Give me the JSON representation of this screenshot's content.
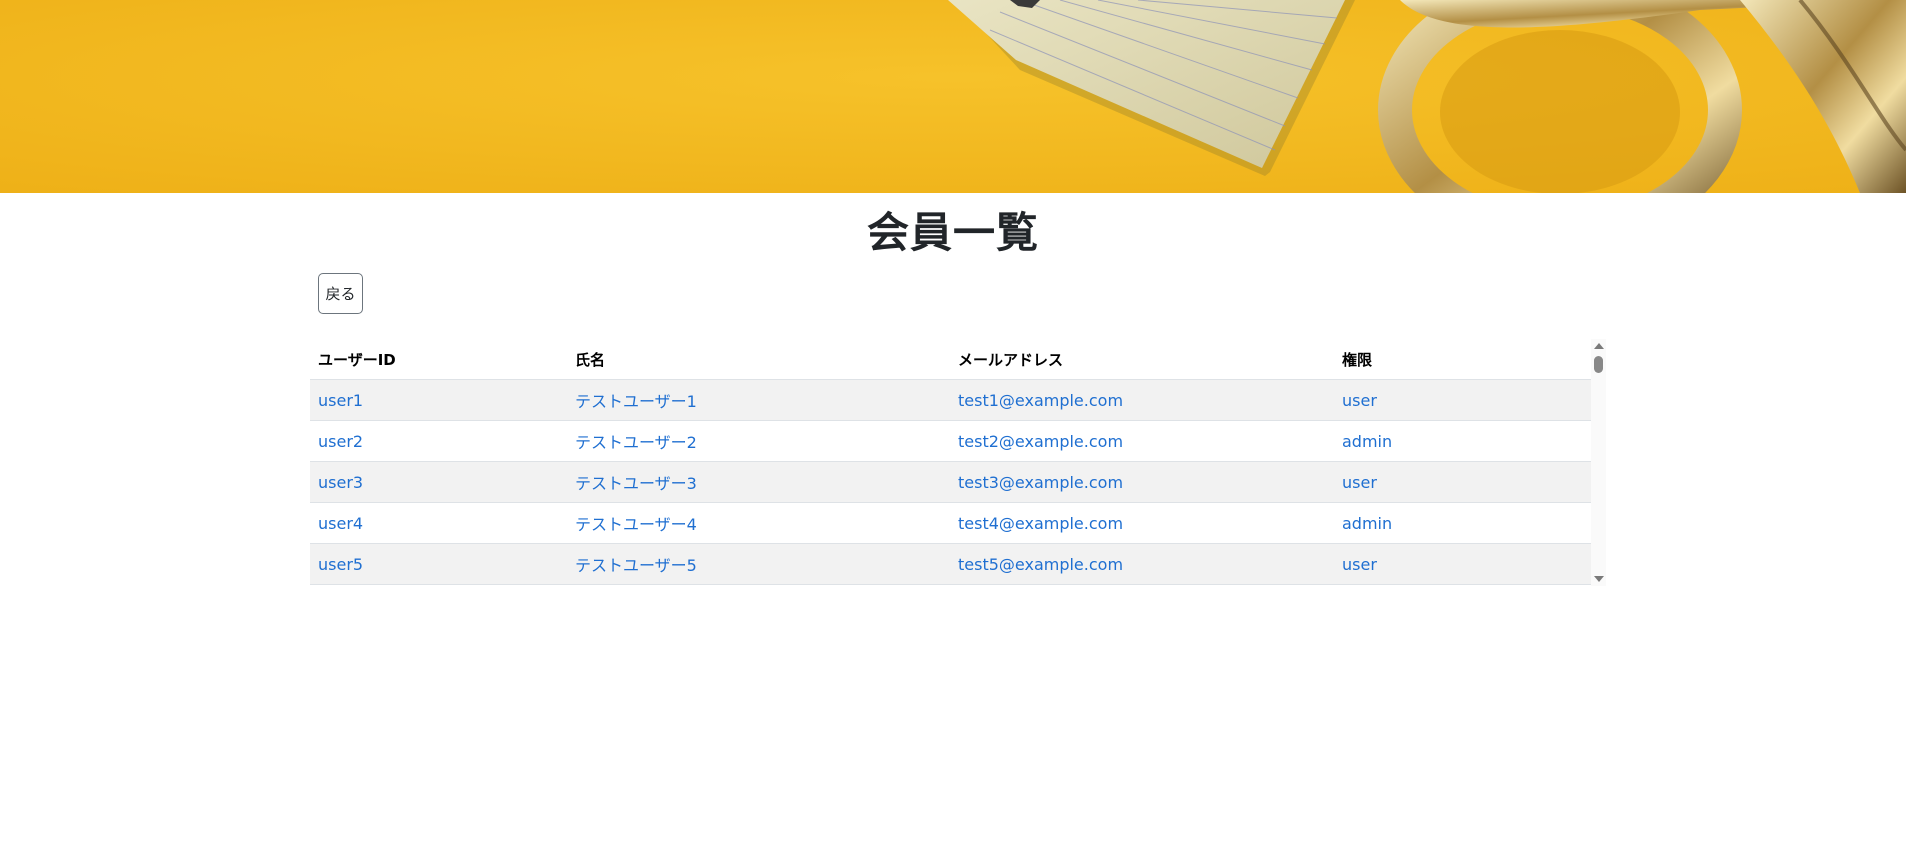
{
  "hero": {
    "image_alt": "office supplies on yellow background"
  },
  "page": {
    "title": "会員一覧",
    "back_label": "戻る"
  },
  "table": {
    "headers": [
      "ユーザーID",
      "氏名",
      "メールアドレス",
      "権限"
    ],
    "rows": [
      {
        "user_id": "user1",
        "name": "テストユーザー1",
        "email": "test1@example.com",
        "role": "user"
      },
      {
        "user_id": "user2",
        "name": "テストユーザー2",
        "email": "test2@example.com",
        "role": "admin"
      },
      {
        "user_id": "user3",
        "name": "テストユーザー3",
        "email": "test3@example.com",
        "role": "user"
      },
      {
        "user_id": "user4",
        "name": "テストユーザー4",
        "email": "test4@example.com",
        "role": "admin"
      },
      {
        "user_id": "user5",
        "name": "テストユーザー5",
        "email": "test5@example.com",
        "role": "user"
      }
    ]
  },
  "colors": {
    "link": "#1f6fd1",
    "hero_background": "#f2b81f",
    "row_striped": "#f2f2f2"
  }
}
